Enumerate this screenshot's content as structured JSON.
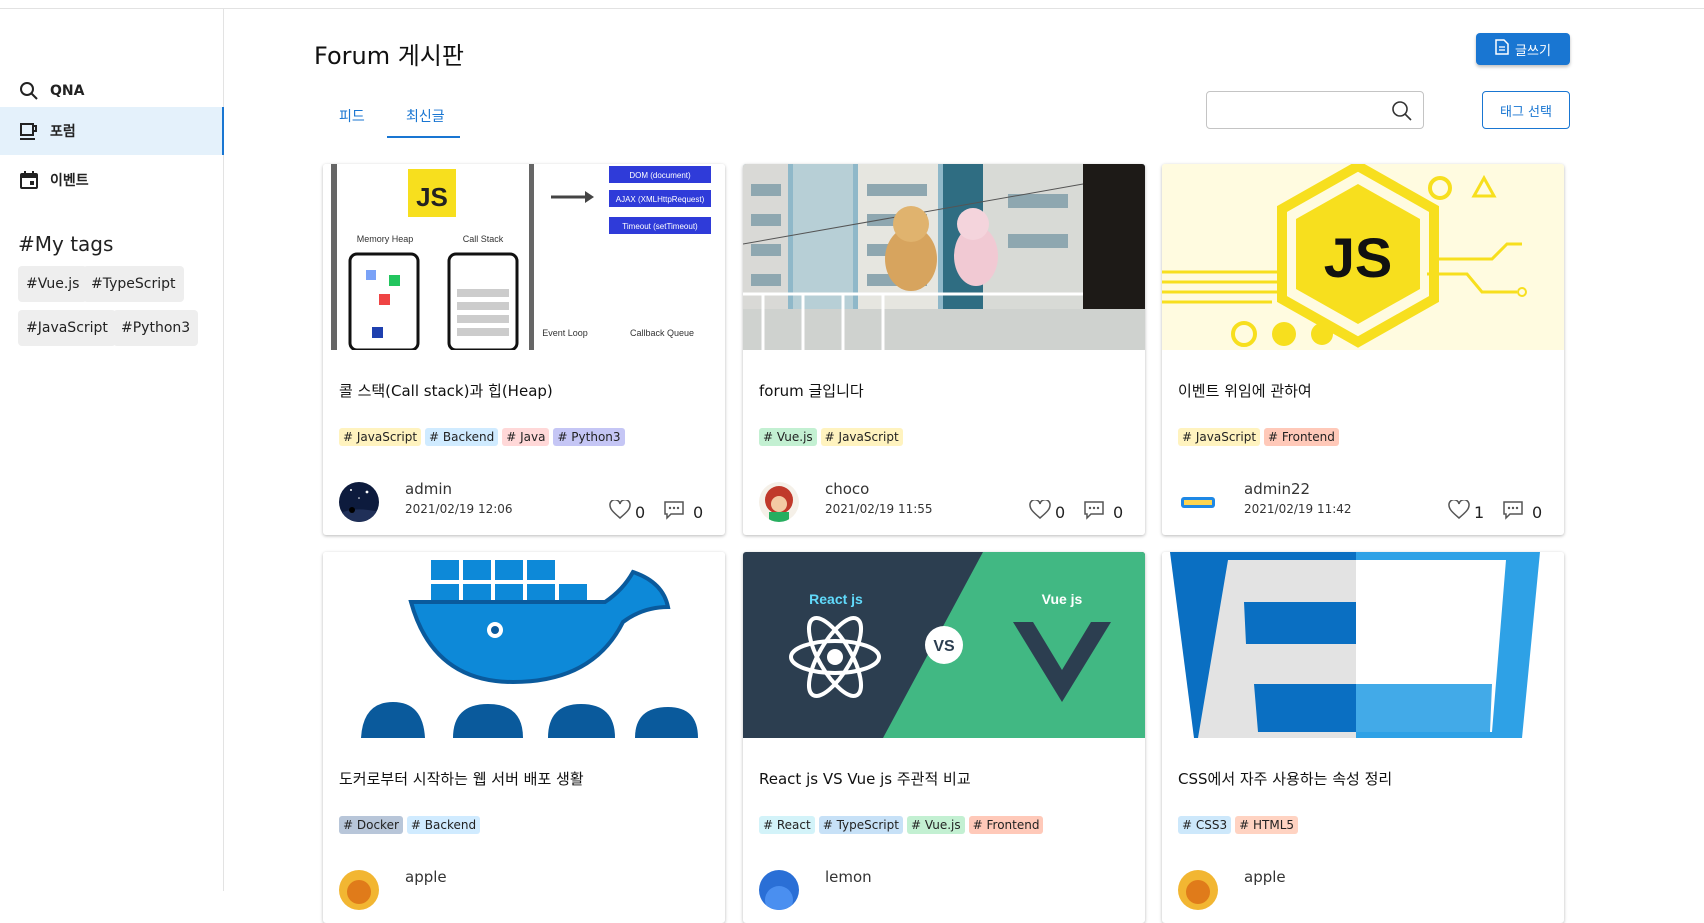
{
  "sidebar": {
    "items": [
      {
        "label": "QNA",
        "icon": "search-icon"
      },
      {
        "label": "포럼",
        "icon": "coffee-cup-icon",
        "active": true
      },
      {
        "label": "이벤트",
        "icon": "calendar-icon"
      }
    ],
    "tags_title": "#My tags",
    "tags": [
      "#Vue.js",
      "#TypeScript",
      "#JavaScript",
      "#Python3"
    ]
  },
  "header": {
    "title": "Forum 게시판",
    "write_label": "글쓰기",
    "tabs": [
      "피드",
      "최신글"
    ],
    "active_tab": "최신글",
    "search": {
      "value": "",
      "placeholder": ""
    },
    "tag_select_label": "태그 선택"
  },
  "image_text": {
    "card1": {
      "js": "JS",
      "memory_heap": "Memory Heap",
      "call_stack": "Call Stack",
      "dom": "DOM (document)",
      "ajax": "AJAX (XMLHttpRequest)",
      "timeout": "Timeout (setTimeout)",
      "event_loop": "Event Loop",
      "callback_queue": "Callback Queue"
    },
    "card3": {
      "js": "JS"
    },
    "card5": {
      "react": "React js",
      "vs": "VS",
      "vue": "Vue js"
    }
  },
  "cards": [
    {
      "title": "콜 스택(Call stack)과 힙(Heap)",
      "tags": [
        "# JavaScript",
        "# Backend",
        "# Java",
        "# Python3"
      ],
      "author": "admin",
      "date": "2021/02/19 12:06",
      "likes": "0",
      "comments": "0"
    },
    {
      "title": "forum 글입니다",
      "tags": [
        "# Vue.js",
        "# JavaScript"
      ],
      "author": "choco",
      "date": "2021/02/19 11:55",
      "likes": "0",
      "comments": "0"
    },
    {
      "title": "이벤트 위임에 관하여",
      "tags": [
        "# JavaScript",
        "# Frontend"
      ],
      "author": "admin22",
      "date": "2021/02/19 11:42",
      "likes": "1",
      "comments": "0"
    },
    {
      "title": "도커로부터 시작하는 웹 서버 배포 생활",
      "tags": [
        "# Docker",
        "# Backend"
      ],
      "author": "apple"
    },
    {
      "title": "React js VS Vue js 주관적 비교",
      "tags": [
        "# React",
        "# TypeScript",
        "# Vue.js",
        "# Frontend"
      ],
      "author": "lemon"
    },
    {
      "title": "CSS에서 자주 사용하는 속성 정리",
      "tags": [
        "# CSS3",
        "# HTML5"
      ],
      "author": "apple"
    }
  ],
  "tag_colors": {
    "JavaScript": "#fff3bf",
    "Backend": "#d0ebff",
    "Java": "#ffd8d8",
    "Python3": "#c5c6f5",
    "Vue.js": "#c3f0d2",
    "Frontend": "#ffc9b9",
    "Docker": "#b8c6d9",
    "React": "#d3f3f9",
    "TypeScript": "#c7e1f7",
    "CSS3": "#cde8fb",
    "HTML5": "#ffd3c2"
  },
  "colors": {
    "accent": "#1976d2"
  }
}
